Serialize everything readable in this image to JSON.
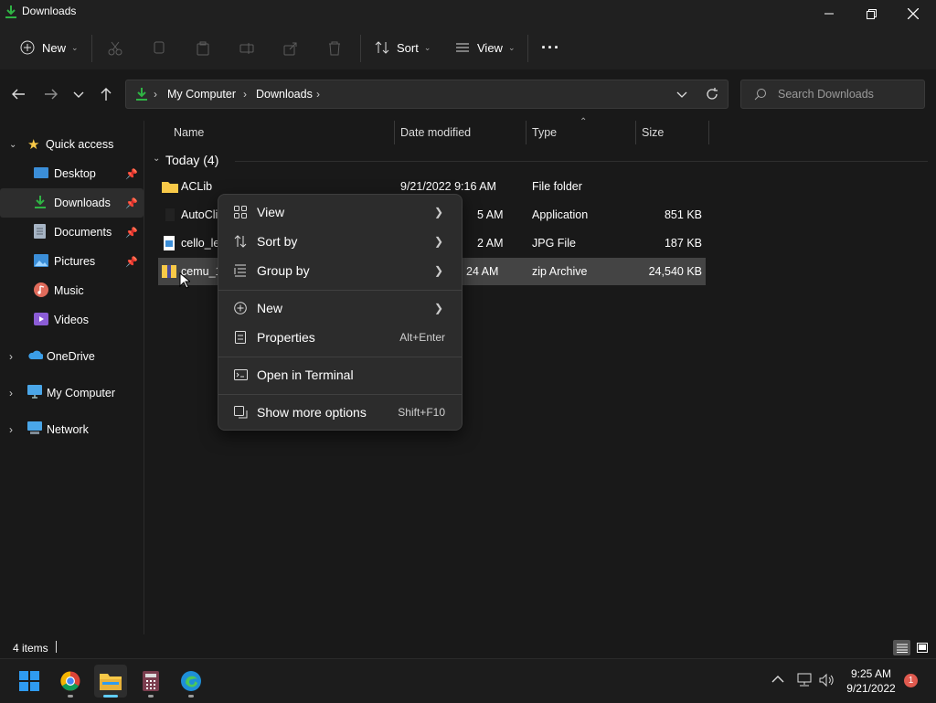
{
  "window": {
    "title": "Downloads"
  },
  "toolbar": {
    "new_label": "New",
    "sort_label": "Sort",
    "view_label": "View",
    "more_label": "···"
  },
  "address": {
    "segments": [
      "My Computer",
      "Downloads"
    ]
  },
  "search": {
    "placeholder": "Search Downloads"
  },
  "sidebar": {
    "items": [
      {
        "label": "Quick access"
      },
      {
        "label": "Desktop"
      },
      {
        "label": "Downloads"
      },
      {
        "label": "Documents"
      },
      {
        "label": "Pictures"
      },
      {
        "label": "Music"
      },
      {
        "label": "Videos"
      },
      {
        "label": "OneDrive"
      },
      {
        "label": "My Computer"
      },
      {
        "label": "Network"
      }
    ]
  },
  "columns": {
    "name": "Name",
    "date": "Date modified",
    "type": "Type",
    "size": "Size"
  },
  "group": {
    "label": "Today (4)"
  },
  "files": [
    {
      "name": "ACLib",
      "date": "9/21/2022 9:16 AM",
      "type": "File folder",
      "size": ""
    },
    {
      "name": "AutoCli",
      "date": "5 AM",
      "type": "Application",
      "size": "851 KB"
    },
    {
      "name": "cello_le",
      "date": "2 AM",
      "type": "JPG File",
      "size": "187 KB"
    },
    {
      "name": "cemu_1",
      "date": "24 AM",
      "type": "zip Archive",
      "size": "24,540 KB"
    }
  ],
  "context_menu": {
    "view": "View",
    "sort_by": "Sort by",
    "group_by": "Group by",
    "new": "New",
    "properties": "Properties",
    "properties_shortcut": "Alt+Enter",
    "open_terminal": "Open in Terminal",
    "more_options": "Show more options",
    "more_options_shortcut": "Shift+F10"
  },
  "status": {
    "items": "4 items"
  },
  "clock": {
    "time": "9:25 AM",
    "date": "9/21/2022",
    "badge": "1"
  },
  "colors": {
    "accent": "#60cdff",
    "folder": "#f8c948",
    "green": "#2fb344",
    "selected": "#444444",
    "badge": "#e05a4f"
  }
}
